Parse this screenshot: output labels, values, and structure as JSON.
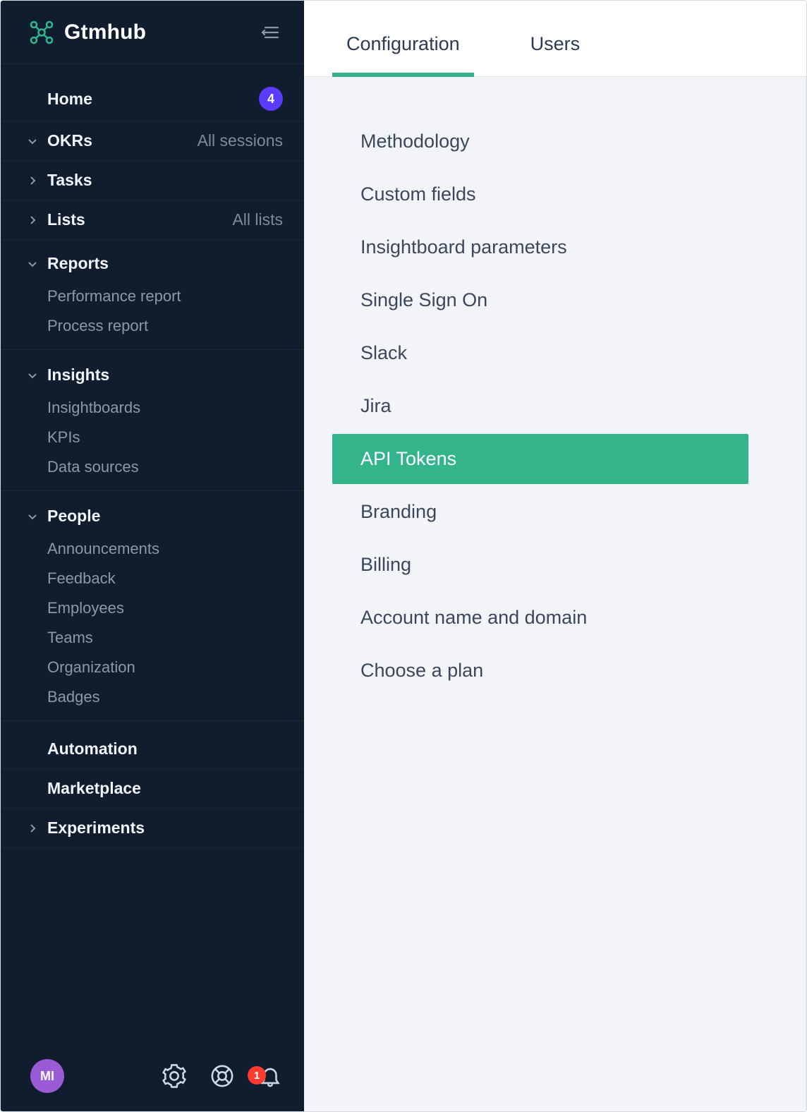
{
  "brand": {
    "name": "Gtmhub",
    "accent": "#2fb48c"
  },
  "sidebar": {
    "home": {
      "label": "Home",
      "badge": "4"
    },
    "okrs": {
      "label": "OKRs",
      "meta": "All sessions"
    },
    "tasks": {
      "label": "Tasks"
    },
    "lists": {
      "label": "Lists",
      "meta": "All lists"
    },
    "reports": {
      "label": "Reports",
      "items": [
        "Performance report",
        "Process report"
      ]
    },
    "insights": {
      "label": "Insights",
      "items": [
        "Insightboards",
        "KPIs",
        "Data sources"
      ]
    },
    "people": {
      "label": "People",
      "items": [
        "Announcements",
        "Feedback",
        "Employees",
        "Teams",
        "Organization",
        "Badges"
      ]
    },
    "automation": {
      "label": "Automation"
    },
    "marketplace": {
      "label": "Marketplace"
    },
    "experiments": {
      "label": "Experiments"
    }
  },
  "footer": {
    "avatar_initials": "MI",
    "notification_count": "1"
  },
  "tabs": {
    "items": [
      "Configuration",
      "Users"
    ],
    "active_index": 0
  },
  "config_menu": {
    "items": [
      "Methodology",
      "Custom fields",
      "Insightboard parameters",
      "Single Sign On",
      "Slack",
      "Jira",
      "API Tokens",
      "Branding",
      "Billing",
      "Account name and domain",
      "Choose a plan"
    ],
    "active_index": 6
  }
}
